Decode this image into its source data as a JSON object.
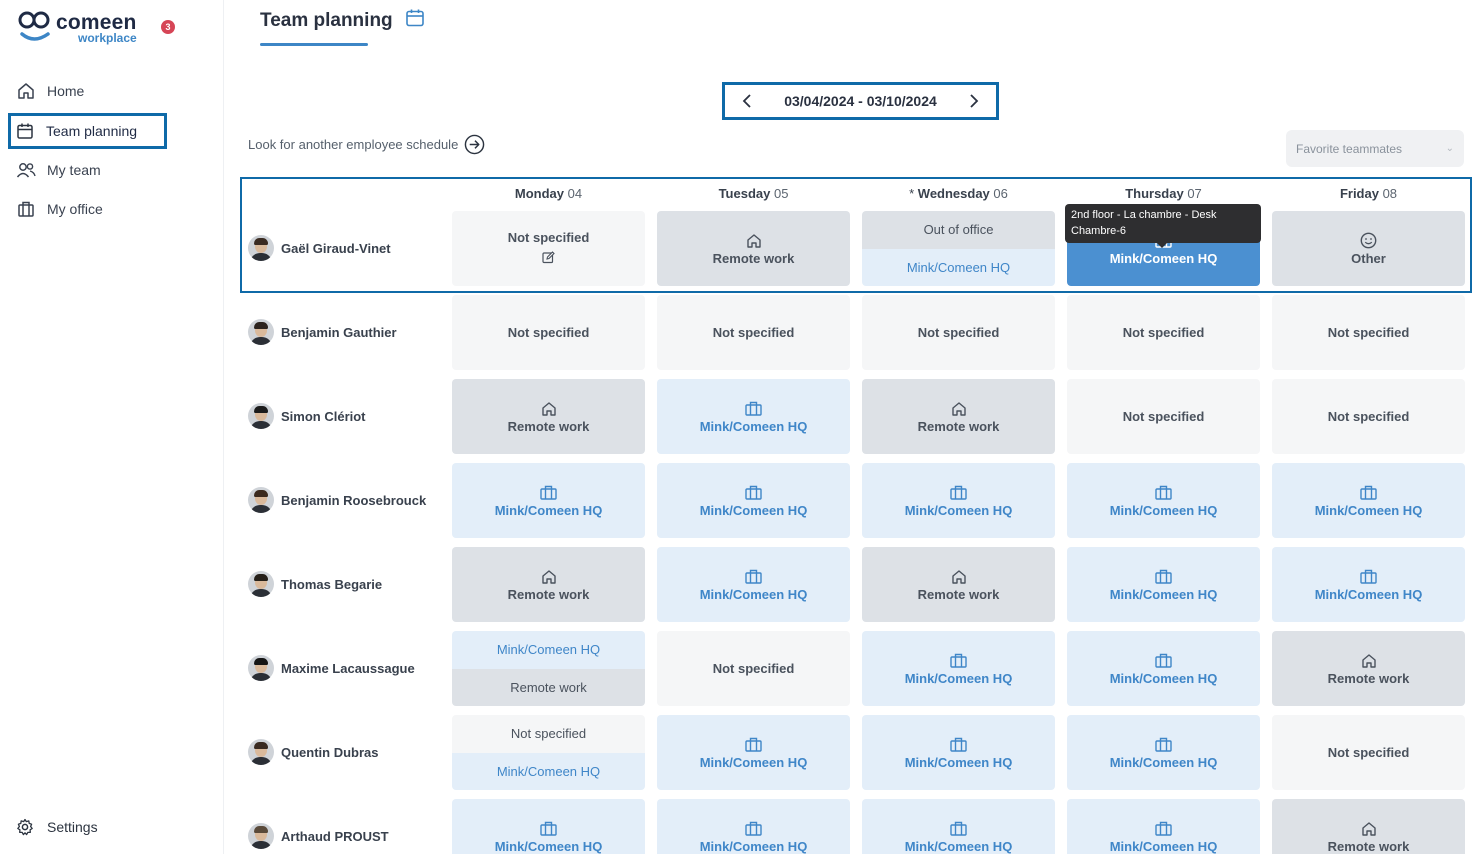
{
  "brand": {
    "name": "comeen",
    "sub": "workplace",
    "notifications": "3",
    "accent": "#3d86c6",
    "focus_border": "#0f6aa8"
  },
  "nav": {
    "items": [
      {
        "label": "Home",
        "icon": "home-icon"
      },
      {
        "label": "Team planning",
        "icon": "calendar-icon",
        "active": true
      },
      {
        "label": "My team",
        "icon": "users-icon"
      },
      {
        "label": "My office",
        "icon": "building-icon"
      }
    ],
    "settings": "Settings"
  },
  "page": {
    "title": "Team planning",
    "date_range": "03/04/2024 - 03/10/2024",
    "lookup": "Look for another employee schedule",
    "favorite_placeholder": "Favorite teammates"
  },
  "days": [
    {
      "star": "",
      "name": "Monday",
      "num": "04"
    },
    {
      "star": "",
      "name": "Tuesday",
      "num": "05"
    },
    {
      "star": "* ",
      "name": "Wednesday",
      "num": "06"
    },
    {
      "star": "",
      "name": "Thursday",
      "num": "07"
    },
    {
      "star": "",
      "name": "Friday",
      "num": "08"
    }
  ],
  "labels": {
    "ns": "Not specified",
    "rw": "Remote work",
    "hq": "Mink/Comeen HQ",
    "ot": "Other",
    "oo": "Out of office"
  },
  "tooltip": "2nd floor - La chambre - Desk Chambre-6",
  "people": [
    {
      "name": "Gaël Giraud-Vinet",
      "cells": [
        "ns-edit",
        "rw",
        "split-oo-hq",
        "sel-hq",
        "ot"
      ]
    },
    {
      "name": "Benjamin Gauthier",
      "cells": [
        "ns",
        "ns",
        "ns",
        "ns",
        "ns"
      ]
    },
    {
      "name": "Simon Clériot",
      "cells": [
        "rw",
        "hq",
        "rw",
        "ns",
        "ns"
      ]
    },
    {
      "name": "Benjamin Roosebrouck",
      "cells": [
        "hq",
        "hq",
        "hq",
        "hq",
        "hq"
      ]
    },
    {
      "name": "Thomas Begarie",
      "cells": [
        "rw",
        "hq",
        "rw",
        "hq",
        "hq"
      ]
    },
    {
      "name": "Maxime Lacaussague",
      "cells": [
        "split-hq-rw",
        "ns",
        "hq",
        "hq",
        "rw"
      ]
    },
    {
      "name": "Quentin Dubras",
      "cells": [
        "split-ns-hq",
        "hq",
        "hq",
        "hq",
        "ns"
      ]
    },
    {
      "name": "Arthaud PROUST",
      "cells": [
        "hq",
        "hq",
        "hq",
        "hq",
        "rw"
      ]
    }
  ]
}
